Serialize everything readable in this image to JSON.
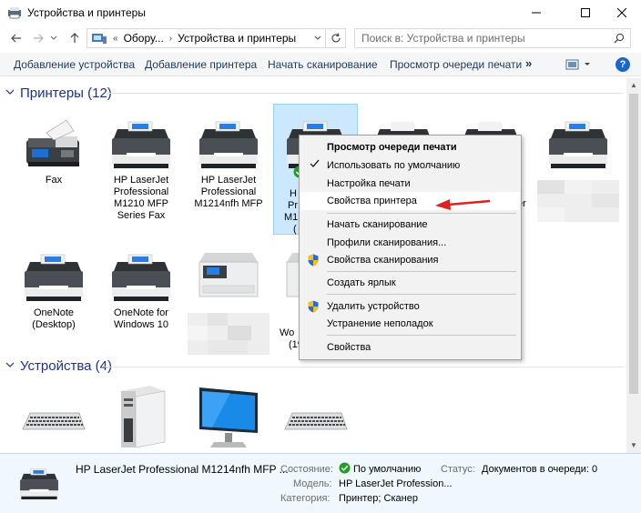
{
  "window": {
    "title": "Устройства и принтеры"
  },
  "address": {
    "crumbs": [
      "Обору...",
      "Устройства и принтеры"
    ],
    "search_placeholder": "Поиск в: Устройства и принтеры"
  },
  "toolbar": {
    "add_device": "Добавление устройства",
    "add_printer": "Добавление принтера",
    "start_scan": "Начать сканирование",
    "print_queue": "Просмотр очереди печати",
    "more": "»",
    "help": "?"
  },
  "groups": {
    "printers": {
      "label": "Принтеры (12)"
    },
    "devices": {
      "label": "Устройства (4)"
    }
  },
  "printers": [
    {
      "label": "Fax",
      "icon": "fax-icon"
    },
    {
      "label": "HP LaserJet Professional M1210 MFP Series Fax",
      "icon": "mfp-printer-icon"
    },
    {
      "label": "HP LaserJet Professional M1214nfh MFP",
      "icon": "mfp-printer-icon"
    },
    {
      "label": "HP LaserJet Professional M1214nfh MFP",
      "icon": "mfp-printer-icon",
      "partial": [
        "H",
        "Pr",
        "M1",
        "("
      ]
    },
    {
      "label": "",
      "icon": "mfp-printer-icon"
    },
    {
      "label": "",
      "icon": "mfp-printer-icon"
    },
    {
      "label": "",
      "icon": "mfp-printer-icon",
      "partial": [
        "er"
      ]
    },
    {
      "label": "OneNote (Desktop)",
      "icon": "mfp-printer-icon"
    },
    {
      "label": "OneNote for Windows 10",
      "icon": "mfp-printer-icon"
    },
    {
      "label": "",
      "icon": "laser-printer-icon"
    },
    {
      "label": "",
      "icon": "laser-printer-icon",
      "partial": [
        "Wo",
        "(19"
      ]
    }
  ],
  "devices": [
    {
      "icon": "keyboard-icon"
    },
    {
      "icon": "computer-tower-icon"
    },
    {
      "icon": "monitor-icon"
    },
    {
      "icon": "keyboard-icon"
    }
  ],
  "context_menu": {
    "items": [
      {
        "label": "Просмотр очереди печати",
        "bold": true
      },
      {
        "label": "Использовать по умолчанию",
        "checked": true
      },
      {
        "label": "Настройка печати"
      },
      {
        "label": "Свойства принтера",
        "highlighted": true
      },
      {
        "label": "Начать сканирование"
      },
      {
        "label": "Профили сканирования..."
      },
      {
        "label": "Свойства сканирования",
        "shield": true
      },
      {
        "label": "Создать ярлык"
      },
      {
        "label": "Удалить устройство",
        "shield": true
      },
      {
        "label": "Устранение неполадок"
      },
      {
        "label": "Свойства"
      }
    ]
  },
  "details": {
    "name": "HP LaserJet Professional M1214nfh MFP ...",
    "state_label": "Состояние:",
    "state_value": "По умолчанию",
    "status_label": "Статус:",
    "status_value": "Документов в очереди: 0",
    "model_label": "Модель:",
    "model_value": "HP LaserJet Profession...",
    "category_label": "Категория:",
    "category_value": "Принтер; Сканер"
  },
  "colors": {
    "accent": "#1a67c9",
    "group_header": "#1e3287",
    "selection": "#cce8ff",
    "ok_green": "#20a020",
    "arrow_red": "#e02020"
  }
}
